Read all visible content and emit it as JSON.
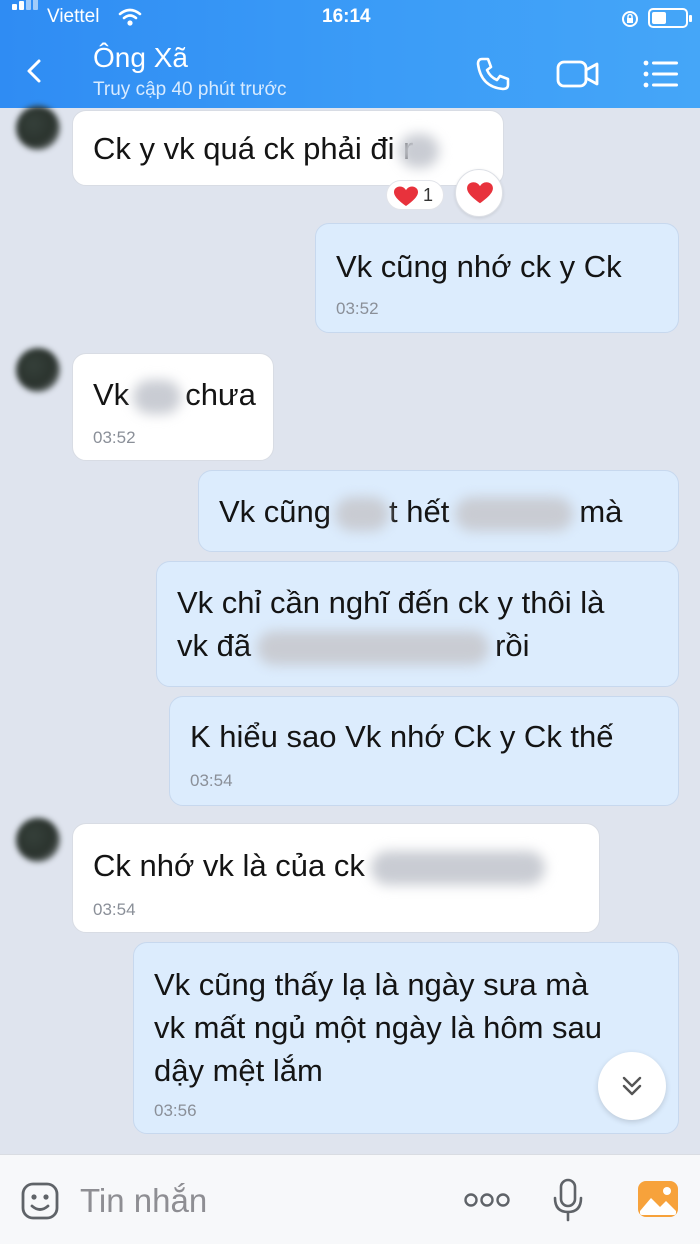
{
  "status_bar": {
    "carrier": "Viettel",
    "time": "16:14"
  },
  "header": {
    "contact_name": "Ông Xã",
    "last_seen": "Truy cập 40 phút trước"
  },
  "messages": [
    {
      "from": "them",
      "text": "Ck y vk quá ck phải đi r",
      "reaction_count": "1"
    },
    {
      "from": "me",
      "text": "Vk cũng nhớ ck y Ck",
      "time": "03:52"
    },
    {
      "from": "them",
      "text_before": "Vk",
      "text_after": "chưa",
      "time": "03:52"
    },
    {
      "from": "me",
      "text_a": "Vk cũng",
      "text_b": "t hết",
      "text_c": "mà"
    },
    {
      "from": "me",
      "line1": "Vk chỉ cần nghĩ đến ck y thôi là",
      "line2_before": "vk đã",
      "line2_after": "rồi"
    },
    {
      "from": "me",
      "text": "K hiểu sao Vk nhớ Ck y Ck thế",
      "time": "03:54"
    },
    {
      "from": "them",
      "text": "Ck nhớ vk là của ck",
      "time": "03:54"
    },
    {
      "from": "me",
      "line1": "Vk cũng thấy lạ là ngày sưa mà",
      "line2": "vk mất ngủ một ngày là hôm sau",
      "line3": "dậy mệt lắm",
      "time": "03:56"
    }
  ],
  "composer": {
    "placeholder": "Tin nhắn"
  },
  "colors": {
    "header": "#3b9cf7",
    "sent_bubble": "#dcecfd",
    "received_bubble": "#ffffff",
    "background": "#dfe4ee",
    "heart": "#e8323c"
  }
}
